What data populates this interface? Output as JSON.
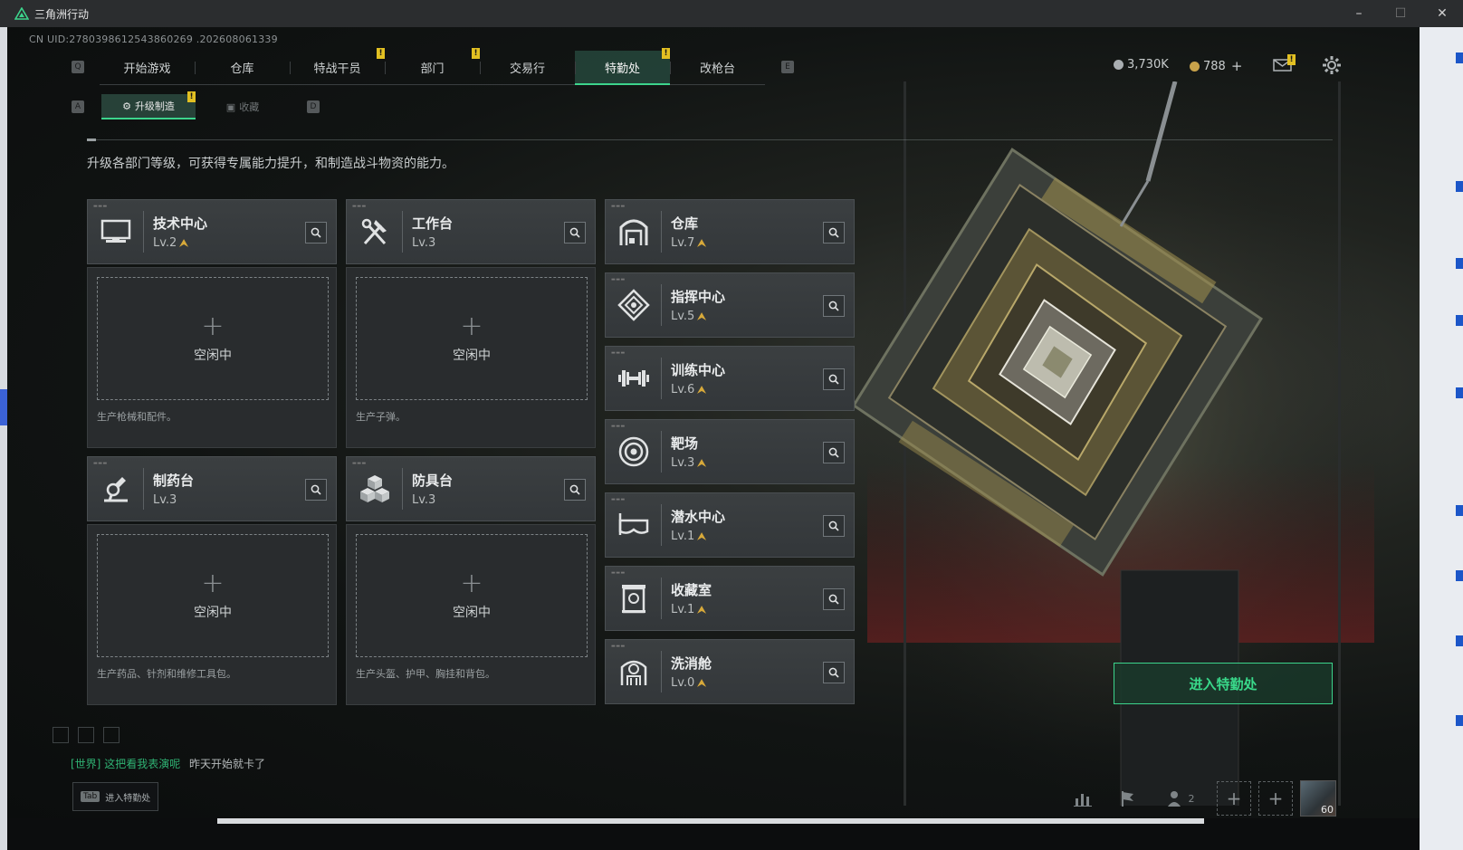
{
  "window": {
    "title": "三角洲行动",
    "minimize": "–",
    "maximize": "☐",
    "close": "✕"
  },
  "uid": "CN UID:2780398612543860269 .202608061339",
  "nav": {
    "left_key": "Q",
    "right_key": "E",
    "tabs": [
      {
        "label": "开始游戏",
        "badge": ""
      },
      {
        "label": "仓库",
        "badge": ""
      },
      {
        "label": "特战干员",
        "badge": "!"
      },
      {
        "label": "部门",
        "badge": "!"
      },
      {
        "label": "交易行",
        "badge": ""
      },
      {
        "label": "特勤处",
        "badge": "!",
        "active": true
      },
      {
        "label": "改枪台",
        "badge": ""
      }
    ]
  },
  "subnav": {
    "left_key": "A",
    "right_key": "D",
    "tabs": [
      {
        "label": "升级制造",
        "active": true,
        "badge": "!"
      },
      {
        "label": "收藏",
        "active": false
      }
    ]
  },
  "currency": {
    "silver": "3,730K",
    "gold": "788",
    "gold_add": "+",
    "mail_badge": "!"
  },
  "description": "升级各部门等级，可获得专属能力提升，和制造战斗物资的能力。",
  "production": [
    {
      "name": "技术中心",
      "level": "Lv.2",
      "upgradable": true,
      "icon": "monitor-icon",
      "slot_plus": "+",
      "slot_status": "空闲中",
      "note": "生产枪械和配件。"
    },
    {
      "name": "工作台",
      "level": "Lv.3",
      "upgradable": false,
      "icon": "tools-icon",
      "slot_plus": "+",
      "slot_status": "空闲中",
      "note": "生产子弹。"
    },
    {
      "name": "制药台",
      "level": "Lv.3",
      "upgradable": false,
      "icon": "microscope-icon",
      "slot_plus": "+",
      "slot_status": "空闲中",
      "note": "生产药品、针剂和维修工具包。"
    },
    {
      "name": "防具台",
      "level": "Lv.3",
      "upgradable": false,
      "icon": "cubes-icon",
      "slot_plus": "+",
      "slot_status": "空闲中",
      "note": "生产头盔、护甲、胸挂和背包。"
    }
  ],
  "facilities": [
    {
      "name": "仓库",
      "level": "Lv.7",
      "upgradable": true,
      "icon": "warehouse-icon"
    },
    {
      "name": "指挥中心",
      "level": "Lv.5",
      "upgradable": true,
      "icon": "command-icon"
    },
    {
      "name": "训练中心",
      "level": "Lv.6",
      "upgradable": true,
      "icon": "dumbbell-icon"
    },
    {
      "name": "靶场",
      "level": "Lv.3",
      "upgradable": true,
      "icon": "target-icon"
    },
    {
      "name": "潜水中心",
      "level": "Lv.1",
      "upgradable": true,
      "icon": "diving-mask-icon"
    },
    {
      "name": "收藏室",
      "level": "Lv.1",
      "upgradable": true,
      "icon": "collection-icon"
    },
    {
      "name": "洗消舱",
      "level": "Lv.0",
      "upgradable": true,
      "icon": "hazmat-icon"
    }
  ],
  "enter_button": "进入特勤处",
  "chat": {
    "channel": "[世界]",
    "sender": "这把看我表演呢",
    "message": "昨天开始就卡了"
  },
  "tab_hint": {
    "key": "Tab",
    "label": "进入特勤处"
  },
  "bottom": {
    "friends_count": "2",
    "avatar_level": "60"
  },
  "colors": {
    "accent": "#3cd48c",
    "badge": "#e2c022",
    "upgrade_arrow": "#d7a93a"
  }
}
